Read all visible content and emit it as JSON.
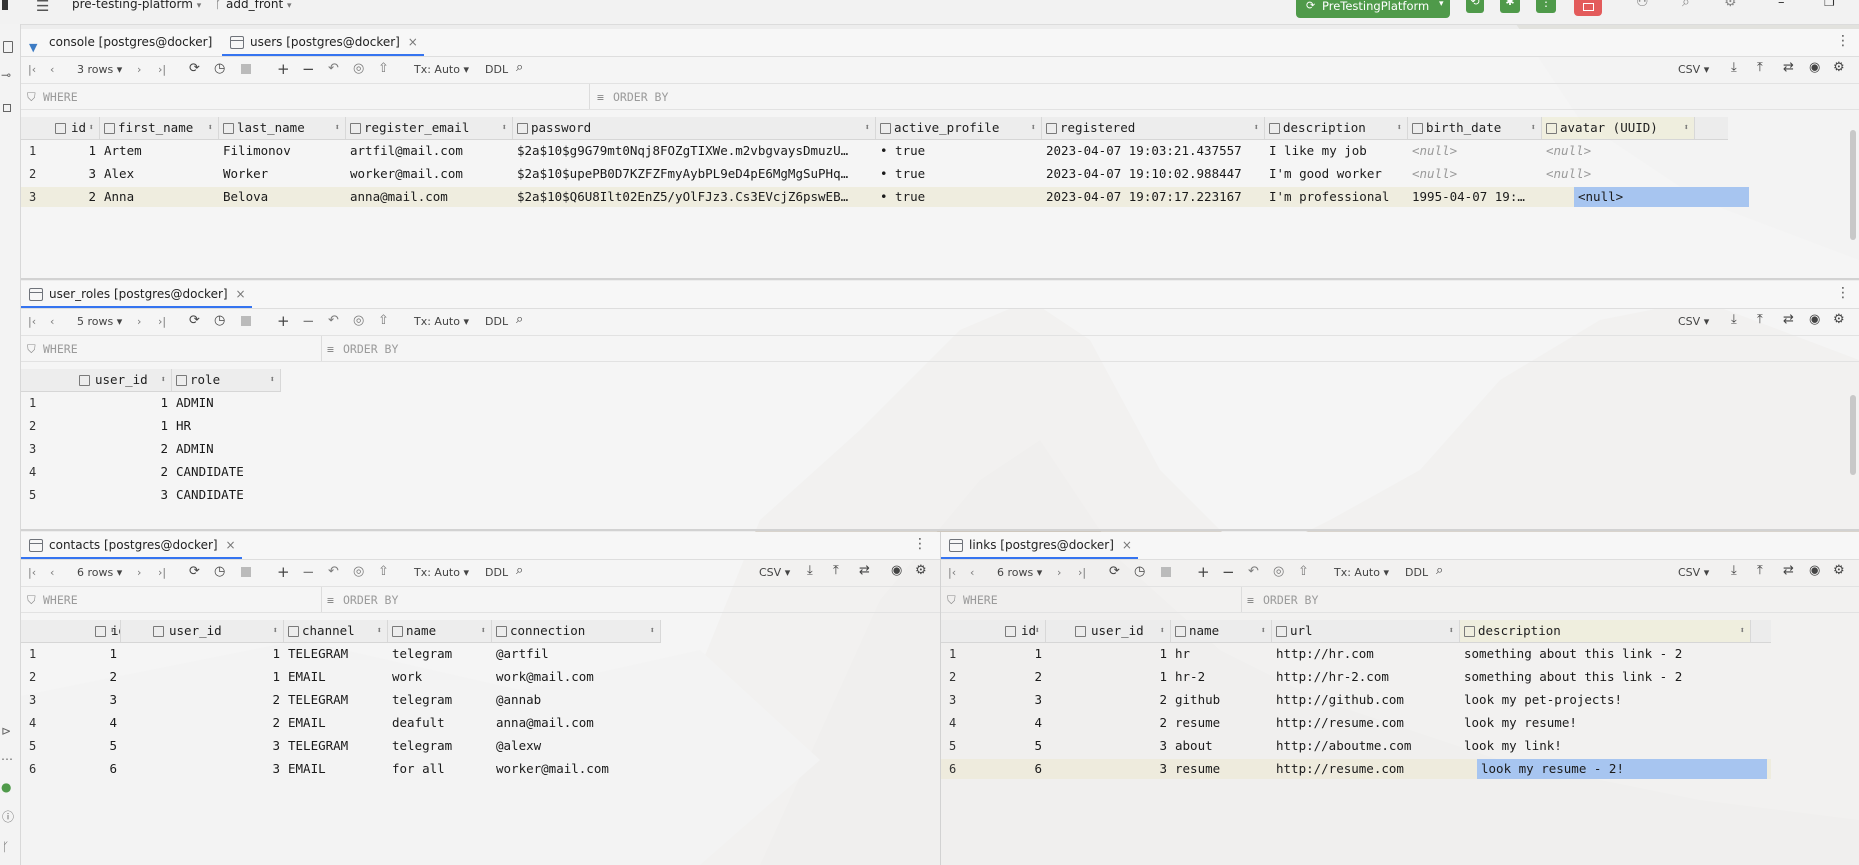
{
  "header": {
    "project": "pre-testing-platform",
    "branch": "add_front",
    "run_config": "PreTestingPlatform"
  },
  "icons": {
    "menu": "hamburger-icon",
    "branch": "branch-icon",
    "table": "table-icon",
    "console": "console-icon"
  },
  "users_panel": {
    "tabs": [
      {
        "label": "console [postgres@docker]"
      },
      {
        "label": "users [postgres@docker]"
      }
    ],
    "toolbar": {
      "rows": "3 rows",
      "tx": "Tx: Auto",
      "ddl": "DDL",
      "export": "CSV"
    },
    "filter": {
      "where": "WHERE",
      "order_by": "ORDER BY"
    },
    "columns": [
      "id",
      "first_name",
      "last_name",
      "register_email",
      "password",
      "active_profile",
      "registered",
      "description",
      "birth_date",
      "avatar (UUID)"
    ],
    "rows": [
      {
        "n": "1",
        "id": "1",
        "first_name": "Artem",
        "last_name": "Filimonov",
        "register_email": "artfil@mail.com",
        "password": "$2a$10$g9G79mt0Nqj8FOZgTIXWe.m2vbgvaysDmuzU…",
        "active_profile": "• true",
        "registered": "2023-04-07 19:03:21.437557",
        "description": "I like my job",
        "birth_date": "<null>",
        "avatar": "<null>"
      },
      {
        "n": "2",
        "id": "3",
        "first_name": "Alex",
        "last_name": "Worker",
        "register_email": "worker@mail.com",
        "password": "$2a$10$upePB0D7KZFZFmyAybPL9eD4pE6MgMgSuPHq…",
        "active_profile": "• true",
        "registered": "2023-04-07 19:10:02.988447",
        "description": "I'm good worker",
        "birth_date": "<null>",
        "avatar": "<null>"
      },
      {
        "n": "3",
        "id": "2",
        "first_name": "Anna",
        "last_name": "Belova",
        "register_email": "anna@mail.com",
        "password": "$2a$10$Q6U8Ilt02EnZ5/yOlFJz3.Cs3EVcjZ6pswEB…",
        "active_profile": "• true",
        "registered": "2023-04-07 19:07:17.223167",
        "description": "I'm professional",
        "birth_date": "1995-04-07 19:…",
        "avatar": "<null>"
      }
    ]
  },
  "roles_panel": {
    "tab": "user_roles [postgres@docker]",
    "toolbar": {
      "rows": "5 rows",
      "tx": "Tx: Auto",
      "ddl": "DDL",
      "export": "CSV"
    },
    "filter": {
      "where": "WHERE",
      "order_by": "ORDER BY"
    },
    "columns": [
      "user_id",
      "role"
    ],
    "rows": [
      {
        "n": "1",
        "user_id": "1",
        "role": "ADMIN"
      },
      {
        "n": "2",
        "user_id": "1",
        "role": "HR"
      },
      {
        "n": "3",
        "user_id": "2",
        "role": "ADMIN"
      },
      {
        "n": "4",
        "user_id": "2",
        "role": "CANDIDATE"
      },
      {
        "n": "5",
        "user_id": "3",
        "role": "CANDIDATE"
      }
    ]
  },
  "contacts_panel": {
    "tab": "contacts [postgres@docker]",
    "toolbar": {
      "rows": "6 rows",
      "tx": "Tx: Auto",
      "ddl": "DDL",
      "export": "CSV"
    },
    "filter": {
      "where": "WHERE",
      "order_by": "ORDER BY"
    },
    "columns": [
      "id",
      "user_id",
      "channel",
      "name",
      "connection"
    ],
    "rows": [
      {
        "n": "1",
        "id": "1",
        "user_id": "1",
        "channel": "TELEGRAM",
        "name": "telegram",
        "connection": "@artfil"
      },
      {
        "n": "2",
        "id": "2",
        "user_id": "1",
        "channel": "EMAIL",
        "name": "work",
        "connection": "work@mail.com"
      },
      {
        "n": "3",
        "id": "3",
        "user_id": "2",
        "channel": "TELEGRAM",
        "name": "telegram",
        "connection": "@annab"
      },
      {
        "n": "4",
        "id": "4",
        "user_id": "2",
        "channel": "EMAIL",
        "name": "deafult",
        "connection": "anna@mail.com"
      },
      {
        "n": "5",
        "id": "5",
        "user_id": "3",
        "channel": "TELEGRAM",
        "name": "telegram",
        "connection": "@alexw"
      },
      {
        "n": "6",
        "id": "6",
        "user_id": "3",
        "channel": "EMAIL",
        "name": "for all",
        "connection": "worker@mail.com"
      }
    ]
  },
  "links_panel": {
    "tab": "links [postgres@docker]",
    "toolbar": {
      "rows": "6 rows",
      "tx": "Tx: Auto",
      "ddl": "DDL",
      "export": "CSV"
    },
    "filter": {
      "where": "WHERE",
      "order_by": "ORDER BY"
    },
    "columns": [
      "id",
      "user_id",
      "name",
      "url",
      "description"
    ],
    "rows": [
      {
        "n": "1",
        "id": "1",
        "user_id": "1",
        "name": "hr",
        "url": "http://hr.com",
        "description": "something about this link - 2"
      },
      {
        "n": "2",
        "id": "2",
        "user_id": "1",
        "name": "hr-2",
        "url": "http://hr-2.com",
        "description": "something about this link - 2"
      },
      {
        "n": "3",
        "id": "3",
        "user_id": "2",
        "name": "github",
        "url": "http://github.com",
        "description": "look my pet-projects!"
      },
      {
        "n": "4",
        "id": "4",
        "user_id": "2",
        "name": "resume",
        "url": "http://resume.com",
        "description": "look my resume!"
      },
      {
        "n": "5",
        "id": "5",
        "user_id": "3",
        "name": "about",
        "url": "http://aboutme.com",
        "description": "look my link!"
      },
      {
        "n": "6",
        "id": "6",
        "user_id": "3",
        "name": "resume",
        "url": "http://resume.com",
        "description": "look my resume - 2!"
      }
    ]
  }
}
